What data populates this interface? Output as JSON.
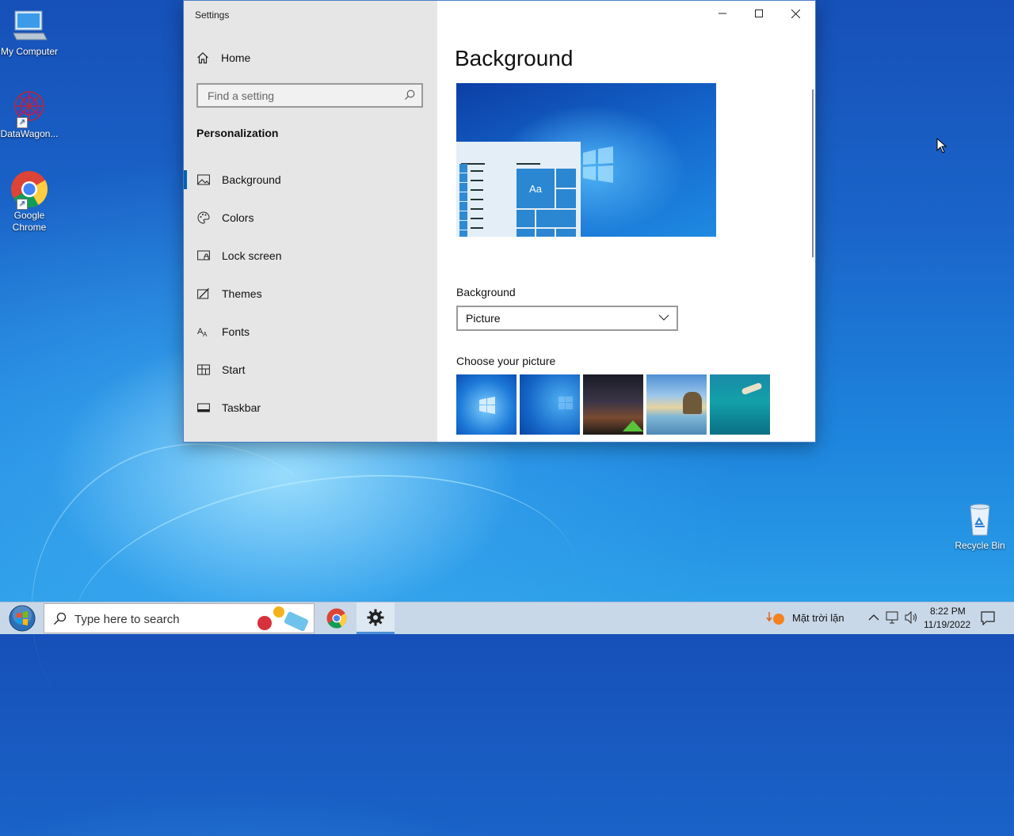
{
  "desktop": {
    "icons": [
      {
        "label": "My Computer",
        "icon": "computer-icon"
      },
      {
        "label": "DataWagon...",
        "icon": "datawagon-icon"
      },
      {
        "label": "Google Chrome",
        "icon": "chrome-icon"
      },
      {
        "label": "Recycle Bin",
        "icon": "recycle-bin-icon"
      }
    ]
  },
  "window": {
    "title": "Settings",
    "controls": {
      "minimize": "minimize-icon",
      "maximize": "maximize-icon",
      "close": "close-icon"
    }
  },
  "sidebar": {
    "home_label": "Home",
    "search_placeholder": "Find a setting",
    "section_title": "Personalization",
    "items": [
      {
        "label": "Background",
        "icon": "picture-icon",
        "active": true
      },
      {
        "label": "Colors",
        "icon": "palette-icon"
      },
      {
        "label": "Lock screen",
        "icon": "lock-screen-icon"
      },
      {
        "label": "Themes",
        "icon": "themes-icon"
      },
      {
        "label": "Fonts",
        "icon": "fonts-icon"
      },
      {
        "label": "Start",
        "icon": "start-icon"
      },
      {
        "label": "Taskbar",
        "icon": "taskbar-icon"
      }
    ]
  },
  "main": {
    "title": "Background",
    "preview_tile_text": "Aa",
    "background_label": "Background",
    "background_value": "Picture",
    "choose_picture_label": "Choose your picture",
    "pictures": [
      "windows-blue-light",
      "windows-blue",
      "night-sky-tent",
      "beach-rocks",
      "underwater-swimmer"
    ]
  },
  "taskbar": {
    "search_placeholder": "Type here to search",
    "weather_text": "Mặt trời lặn",
    "time": "8:22 PM",
    "date": "11/19/2022",
    "accent": "#4c8fd6"
  }
}
